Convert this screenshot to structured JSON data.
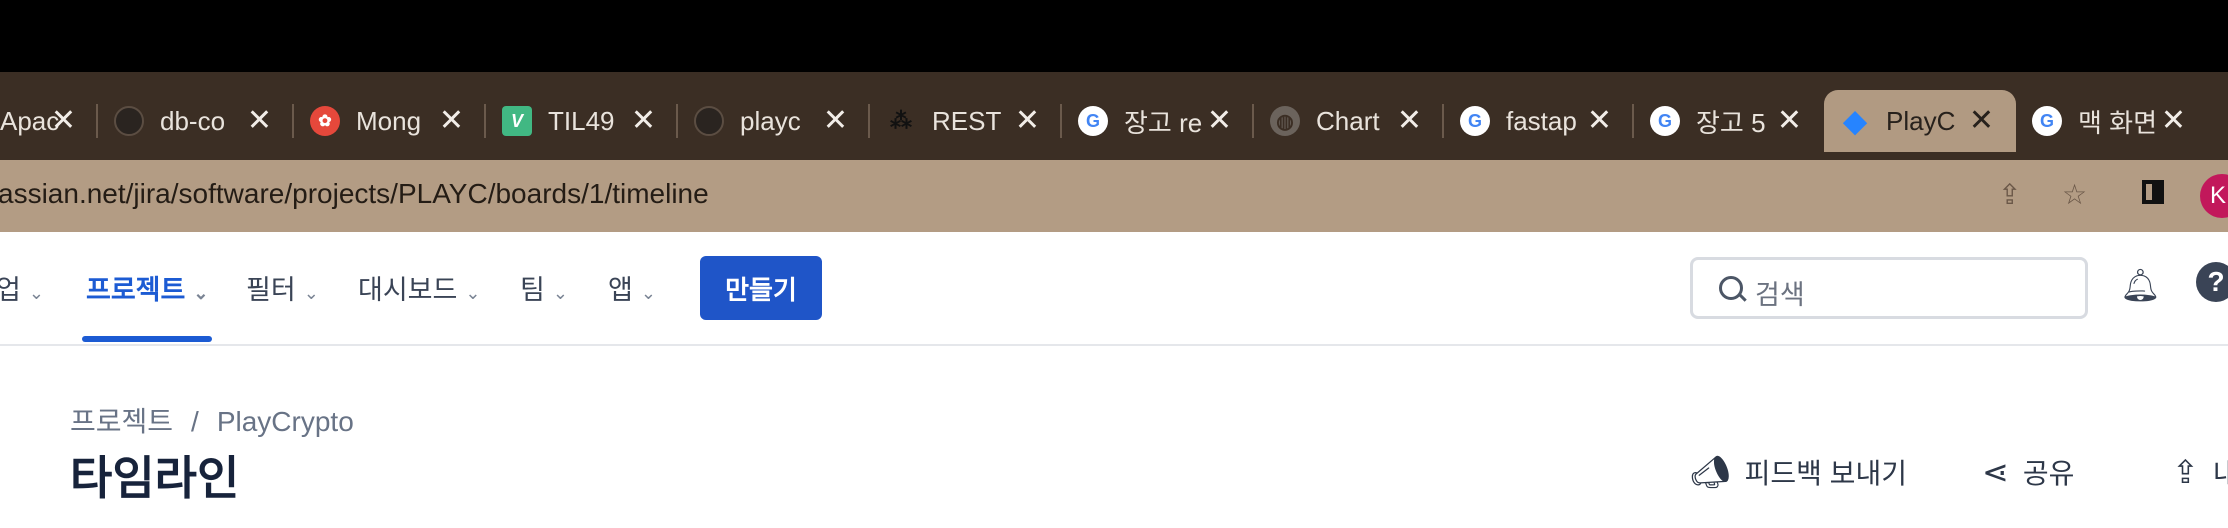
{
  "browser": {
    "tabs": [
      {
        "title": "Apac",
        "icon": "apache-icon"
      },
      {
        "title": "db-co",
        "icon": "github-icon"
      },
      {
        "title": "Mong",
        "icon": "mongodb-icon"
      },
      {
        "title": "TIL49",
        "icon": "vue-icon"
      },
      {
        "title": "playc",
        "icon": "github-icon"
      },
      {
        "title": "REST",
        "icon": "rest-icon"
      },
      {
        "title": "장고 re",
        "icon": "google-icon"
      },
      {
        "title": "Chart",
        "icon": "globe-icon"
      },
      {
        "title": "fastap",
        "icon": "google-icon"
      },
      {
        "title": "장고 5",
        "icon": "google-icon"
      },
      {
        "title": "PlayC",
        "icon": "jira-icon",
        "active": true
      },
      {
        "title": "맥 화면",
        "icon": "google-icon"
      }
    ],
    "close_glyph": "✕",
    "url": "assian.net/jira/software/projects/PLAYC/boards/1/timeline",
    "profile_initial": "K"
  },
  "nav": {
    "items": [
      "업",
      "프로젝트",
      "필터",
      "대시보드",
      "팀",
      "앱"
    ],
    "active_index": 1,
    "create_label": "만들기",
    "search_placeholder": "검색",
    "help_glyph": "?"
  },
  "page": {
    "breadcrumb": {
      "root": "프로젝트",
      "separator": "/",
      "current": "PlayCrypto"
    },
    "title": "타임라인",
    "actions": {
      "feedback": "피드백 보내기",
      "share": "공유",
      "export": "내"
    }
  },
  "colors": {
    "accent": "#1f55c8",
    "tab_active": "#b19a82",
    "tabstrip": "#3b2e24",
    "title": "#17233b"
  }
}
